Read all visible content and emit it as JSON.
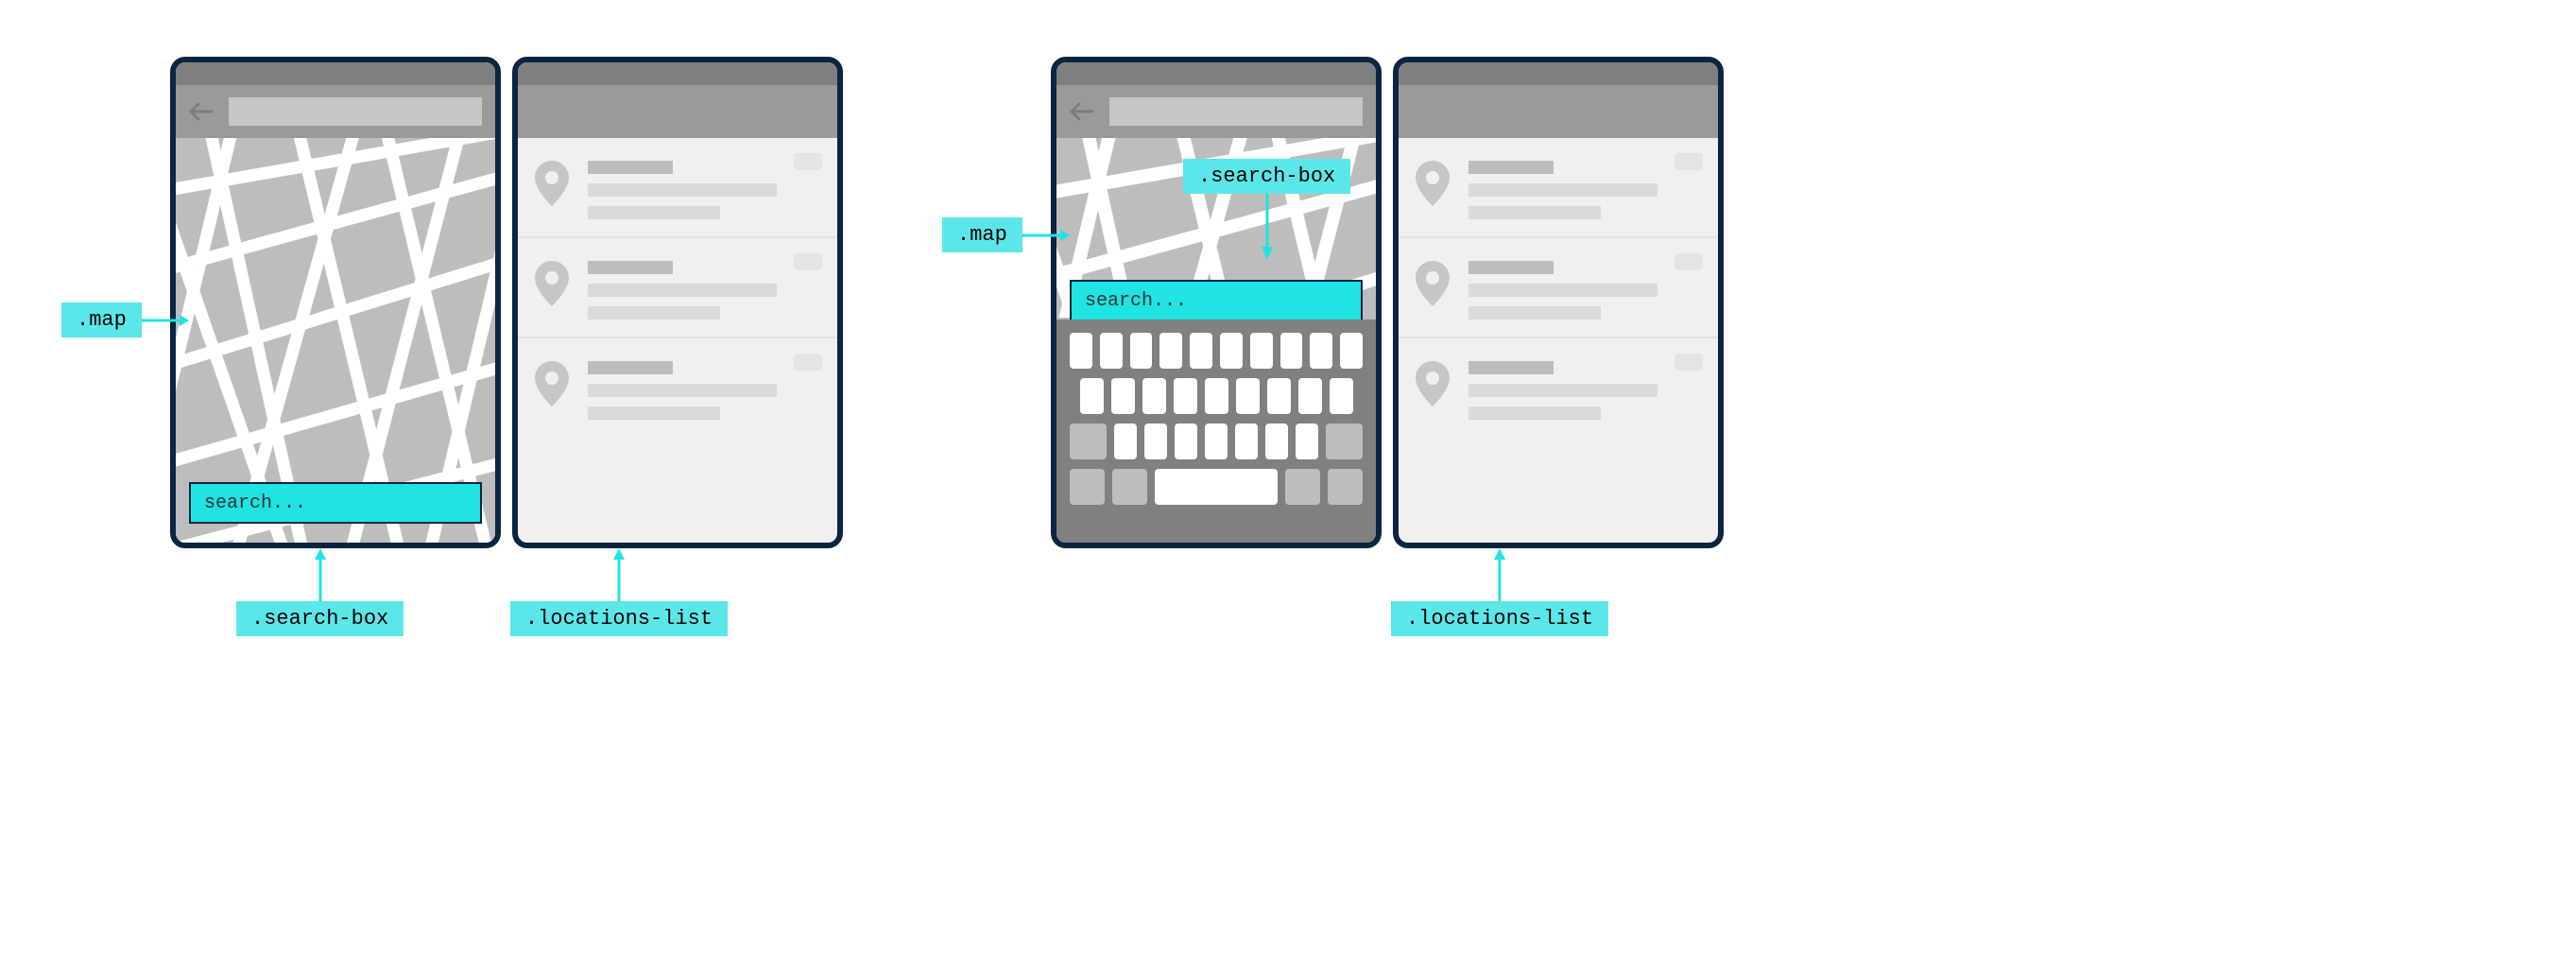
{
  "scene_a": {
    "search_placeholder": "search...",
    "callouts": {
      "map": ".map",
      "search_box": ".search-box",
      "locations_list": ".locations-list"
    }
  },
  "scene_b": {
    "search_placeholder": "search...",
    "callouts": {
      "map": ".map",
      "search_box": ".search-box",
      "locations_list": ".locations-list"
    }
  },
  "colors": {
    "frame": "#0a2540",
    "accent": "#20e3e3",
    "callout_bg": "#5be7ea",
    "gray_dark": "#7f7f7f",
    "gray_mid": "#9a9a9a",
    "gray_light": "#bdbdbd",
    "panel_bg": "#f0f0f0"
  }
}
